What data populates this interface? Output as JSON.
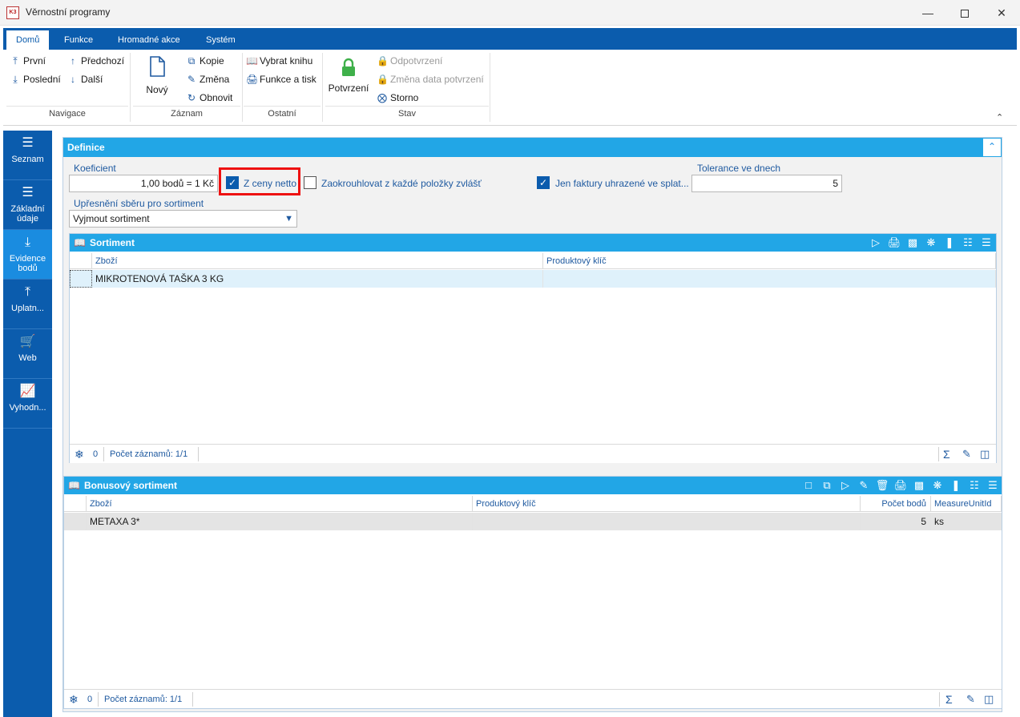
{
  "window": {
    "title": "Věrnostní programy",
    "icon_text": "K3"
  },
  "tabs": [
    {
      "label": "Domů"
    },
    {
      "label": "Funkce"
    },
    {
      "label": "Hromadné akce"
    },
    {
      "label": "Systém"
    }
  ],
  "ribbon": {
    "navigace": {
      "label": "Navigace",
      "first": "První",
      "prev": "Předchozí",
      "last": "Poslední",
      "next": "Další"
    },
    "zaznam": {
      "label": "Záznam",
      "new": "Nový",
      "copy": "Kopie",
      "change": "Změna",
      "refresh": "Obnovit"
    },
    "ostatni": {
      "label": "Ostatní",
      "book": "Vybrat knihu",
      "print": "Funkce a tisk"
    },
    "stav": {
      "label": "Stav",
      "confirm": "Potvrzení",
      "unconfirm": "Odpotvrzení",
      "change_date": "Změna data potvrzení",
      "cancel": "Storno"
    }
  },
  "leftnav": [
    {
      "label": "Seznam"
    },
    {
      "label": "Základní údaje"
    },
    {
      "label": "Evidence bodů"
    },
    {
      "label": "Uplatn..."
    },
    {
      "label": "Web"
    },
    {
      "label": "Vyhodn..."
    }
  ],
  "definice": {
    "title": "Definice",
    "koeficient_label": "Koeficient",
    "koeficient_value": "1,00 bodů = 1 Kč",
    "z_ceny_netto": "Z ceny netto",
    "zaokrouhlovat": "Zaokrouhlovat z každé položky zvlášť",
    "jen_faktury": "Jen faktury uhrazené ve splat...",
    "tolerance_label": "Tolerance ve dnech",
    "tolerance_value": "5",
    "upresneni_label": "Upřesnění sběru pro sortiment",
    "upresneni_value": "Vyjmout sortiment"
  },
  "sortiment": {
    "title": "Sortiment",
    "columns": [
      "Zboží",
      "Produktový klíč"
    ],
    "rows": [
      {
        "zbozi": "MIKROTENOVÁ TAŠKA 3 KG",
        "klic": ""
      }
    ],
    "footer_count": "0",
    "footer_records": "Počet záznamů: 1/1"
  },
  "bonus": {
    "title": "Bonusový sortiment",
    "columns": [
      "Zboží",
      "Produktový klíč",
      "Počet bodů",
      "MeasureUnitId"
    ],
    "rows": [
      {
        "zbozi": "METAXA 3*",
        "klic": "",
        "body": "5",
        "unit": "ks"
      }
    ],
    "footer_count": "0",
    "footer_records": "Počet záznamů: 1/1"
  }
}
